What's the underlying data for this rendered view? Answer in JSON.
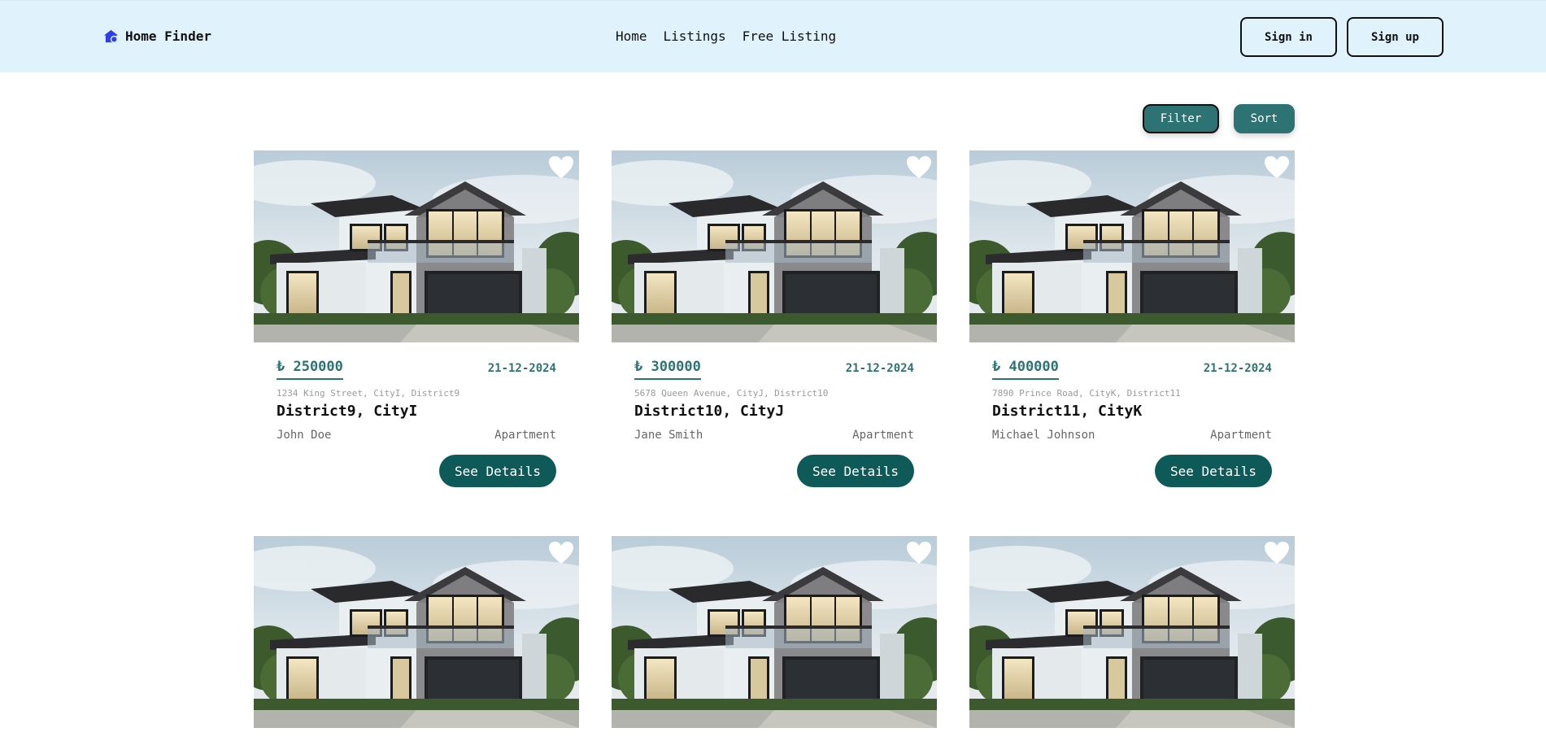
{
  "brand": {
    "name": "Home Finder",
    "icon": "house-icon",
    "color": "#2f3fe6"
  },
  "nav": {
    "links": [
      "Home",
      "Listings",
      "Free Listing"
    ]
  },
  "auth": {
    "signin": "Sign in",
    "signup": "Sign up"
  },
  "toolbar": {
    "filter": "Filter",
    "sort": "Sort"
  },
  "colors": {
    "navbar_bg": "#e0f2fc",
    "accent": "#2e7374",
    "button": "#0e5a58"
  },
  "listings": [
    {
      "price": "₺ 250000",
      "date": "21-12-2024",
      "address": "1234 King Street, CityI, District9",
      "location": "District9, CityI",
      "owner": "John Doe",
      "type": "Apartment",
      "button": "See Details"
    },
    {
      "price": "₺ 300000",
      "date": "21-12-2024",
      "address": "5678 Queen Avenue, CityJ, District10",
      "location": "District10, CityJ",
      "owner": "Jane Smith",
      "type": "Apartment",
      "button": "See Details"
    },
    {
      "price": "₺ 400000",
      "date": "21-12-2024",
      "address": "7890 Prince Road, CityK, District11",
      "location": "District11, CityK",
      "owner": "Michael Johnson",
      "type": "Apartment",
      "button": "See Details"
    },
    {
      "image": "house-photo"
    },
    {
      "image": "house-photo"
    },
    {
      "image": "house-photo"
    }
  ]
}
